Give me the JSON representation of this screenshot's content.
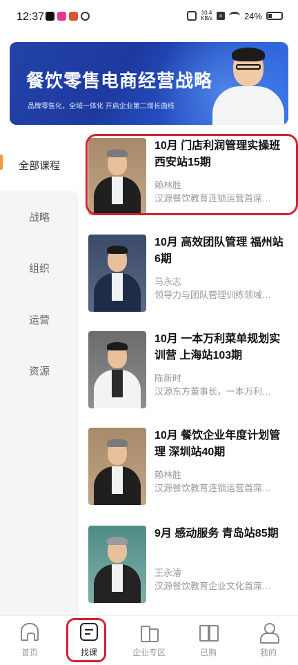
{
  "status_bar": {
    "time": "12:37",
    "net_speed_value": "10.4",
    "net_speed_unit": "KB/s",
    "battery": "24%"
  },
  "banner": {
    "title": "餐饮零售电商经营战略",
    "subtitle": "品牌零售化，全域一体化   开启企业第二增长曲线"
  },
  "sidebar": {
    "items": [
      {
        "label": "全部课程",
        "active": true
      },
      {
        "label": "战略",
        "active": false
      },
      {
        "label": "组织",
        "active": false
      },
      {
        "label": "运营",
        "active": false
      },
      {
        "label": "资源",
        "active": false
      }
    ]
  },
  "courses": [
    {
      "title": "10月 门店利润管理实操班 西安站15期",
      "instructor": "赖林胜",
      "description": "汉源餐饮教育连锁运营首席…"
    },
    {
      "title": "10月  高效团队管理 福州站 6期",
      "instructor": "马永志",
      "description": "领导力与团队管理训练领域…"
    },
    {
      "title": "10月 一本万利菜单规划实训营 上海站103期",
      "instructor": "陈新时",
      "description": "汉源东方董事长，一本万利…"
    },
    {
      "title": "10月 餐饮企业年度计划管理 深圳站40期",
      "instructor": "赖林胜",
      "description": "汉源餐饮教育连锁运营首席…"
    },
    {
      "title": "9月 感动服务 青岛站85期",
      "instructor": "王永濬",
      "description": "汉源餐饮教育企业文化首席…"
    }
  ],
  "bottom_nav": {
    "items": [
      {
        "label": "首页",
        "icon": "home-icon"
      },
      {
        "label": "找课",
        "icon": "course-search-icon",
        "active": true
      },
      {
        "label": "企业专区",
        "icon": "enterprise-icon"
      },
      {
        "label": "已购",
        "icon": "purchased-book-icon"
      },
      {
        "label": "我的",
        "icon": "profile-icon"
      }
    ]
  },
  "colors": {
    "accent": "#f29b38",
    "highlight": "#d0212d",
    "banner_blue": "#1d3aa0"
  }
}
